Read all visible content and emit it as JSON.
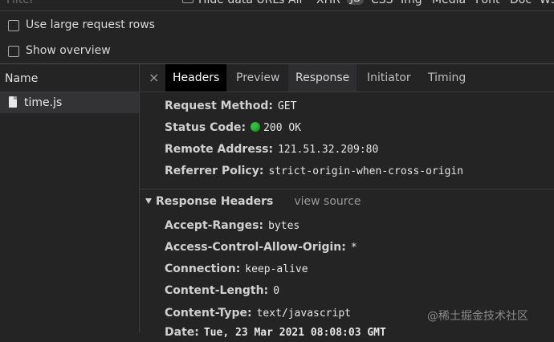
{
  "filter_bar": {
    "filter_placeholder": "Filter",
    "hide_data_urls_label": "Hide data URLs",
    "types": [
      "All",
      "XHR",
      "JS",
      "CSS",
      "Img",
      "Media",
      "Font",
      "Doc",
      "WS"
    ]
  },
  "options": {
    "large_rows_label": "Use large request rows",
    "show_overview_label": "Show overview"
  },
  "name_column": {
    "header": "Name",
    "file": "time.js"
  },
  "tabs": {
    "close": "×",
    "headers": "Headers",
    "preview": "Preview",
    "response": "Response",
    "initiator": "Initiator",
    "timing": "Timing"
  },
  "general": {
    "request_method": {
      "key": "Request Method:",
      "value": "GET"
    },
    "status_code": {
      "key": "Status Code:",
      "value": "200 OK",
      "dot_color": "#2fbf3a"
    },
    "remote_address": {
      "key": "Remote Address:",
      "value": "121.51.32.209:80"
    },
    "referrer_policy": {
      "key": "Referrer Policy:",
      "value": "strict-origin-when-cross-origin"
    }
  },
  "response_headers": {
    "title": "Response Headers",
    "view_source": "view source",
    "accept_ranges": {
      "key": "Accept-Ranges:",
      "value": "bytes"
    },
    "acao": {
      "key": "Access-Control-Allow-Origin:",
      "value": "*"
    },
    "connection": {
      "key": "Connection:",
      "value": "keep-alive"
    },
    "content_length": {
      "key": "Content-Length:",
      "value": "0"
    },
    "content_type": {
      "key": "Content-Type:",
      "value": "text/javascript"
    },
    "date": {
      "key": "Date:",
      "value": "Tue, 23 Mar 2021 08:08:03 GMT"
    }
  },
  "watermark": "@稀土掘金技术社区"
}
